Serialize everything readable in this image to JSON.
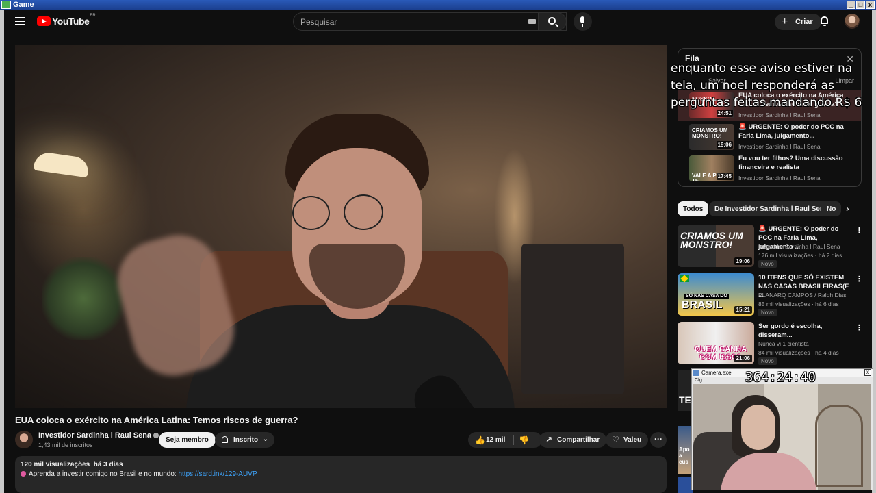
{
  "window": {
    "title": "Game",
    "min": "_",
    "max": "□",
    "close": "x"
  },
  "masthead": {
    "logo_text": "YouTube",
    "country_code": "BR",
    "search_placeholder": "Pesquisar",
    "create_label": "Criar",
    "create_plus": "+",
    "colors": {
      "brand": "#ff0000",
      "bg": "#0f0f0f"
    }
  },
  "video": {
    "title": "EUA coloca o exército na América Latina: Temos riscos de guerra?",
    "channel_name": "Investidor Sardinha l Raul Sena",
    "subscribers": "1,43 mil de inscritos",
    "member_label": "Seja membro",
    "subscribed_label": "Inscrito",
    "subscribed_chevron": "⌄",
    "likes": "12 mil",
    "like_glyph": "👍",
    "dislike_glyph": "👎",
    "share_label": "Compartilhar",
    "share_glyph": "↗",
    "thanks_label": "Valeu",
    "thanks_glyph": "♡",
    "more_glyph": "···",
    "description": {
      "views": "120 mil visualizações",
      "age": "há 3 dias",
      "line": "Aprenda a investir comigo no Brasil e no mundo: ",
      "link": "https://sard.ink/129-AUVP"
    }
  },
  "queue": {
    "title": "Fila",
    "save": "Salvar",
    "clear": "Limpar",
    "close_glyph": "✕",
    "items": [
      {
        "title": "EUA coloca o exército na América Latina: Temos riscos de guerra?",
        "channel": "Investidor Sardinha l Raul Sena",
        "duration": "24:51",
        "thumb_label": "NOSSO F"
      },
      {
        "title": "🚨 URGENTE: O poder do PCC na Faria Lima, julgamento...",
        "channel": "Investidor Sardinha l Raul Sena",
        "duration": "19:06",
        "thumb_label": "CRIAMOS UM MONSTRO!"
      },
      {
        "title": "Eu vou ter filhos? Uma discussão financeira e realista",
        "channel": "Investidor Sardinha l Raul Sena",
        "duration": "17:45",
        "thumb_label": "VALE A PENA TE"
      }
    ]
  },
  "overlay_text": "enquanto esse aviso estiver na tela, um noel responderá as perguntas feitas mandando R$ 6",
  "chips": {
    "items": [
      "Todos",
      "De Investidor Sardinha l Raul Sena",
      "No"
    ],
    "next_glyph": "›"
  },
  "recommendations": [
    {
      "title": "🚨 URGENTE: O poder do PCC na Faria Lima, julgamento ...",
      "channel": "Investidor Sardinha l Raul Sena",
      "stats": "176 mil visualizações · há 2 dias",
      "badge": "Novo",
      "duration": "19:06",
      "thumb_text": "CRIAMOS UM MONSTRO!"
    },
    {
      "title": "10 ITENS QUE SÓ EXISTEM NAS CASAS BRASILEIRAS(E ...",
      "channel": "PLANARQ CAMPOS / Ralph Dias",
      "stats": "85 mil visualizações · há 6 dias",
      "badge": "Novo",
      "duration": "15:21",
      "thumb_small": "SÓ NAS CASA DO",
      "thumb_text": "BRASIL"
    },
    {
      "title": "Ser gordo é escolha, disseram...",
      "channel": "Nunca vi 1 cientista",
      "stats": "84 mil visualizações · há 4 dias",
      "badge": "Novo",
      "duration": "21:06",
      "thumb_text": "QUEM GANHA COM ISSO?"
    }
  ],
  "partial_recs": {
    "rec4_text": "TE",
    "rec5_text": "Apo a cus"
  },
  "camera": {
    "title": "Camera.exe",
    "subtitle": "Cfg",
    "timer": "364:24:40",
    "close_glyph": "x"
  }
}
